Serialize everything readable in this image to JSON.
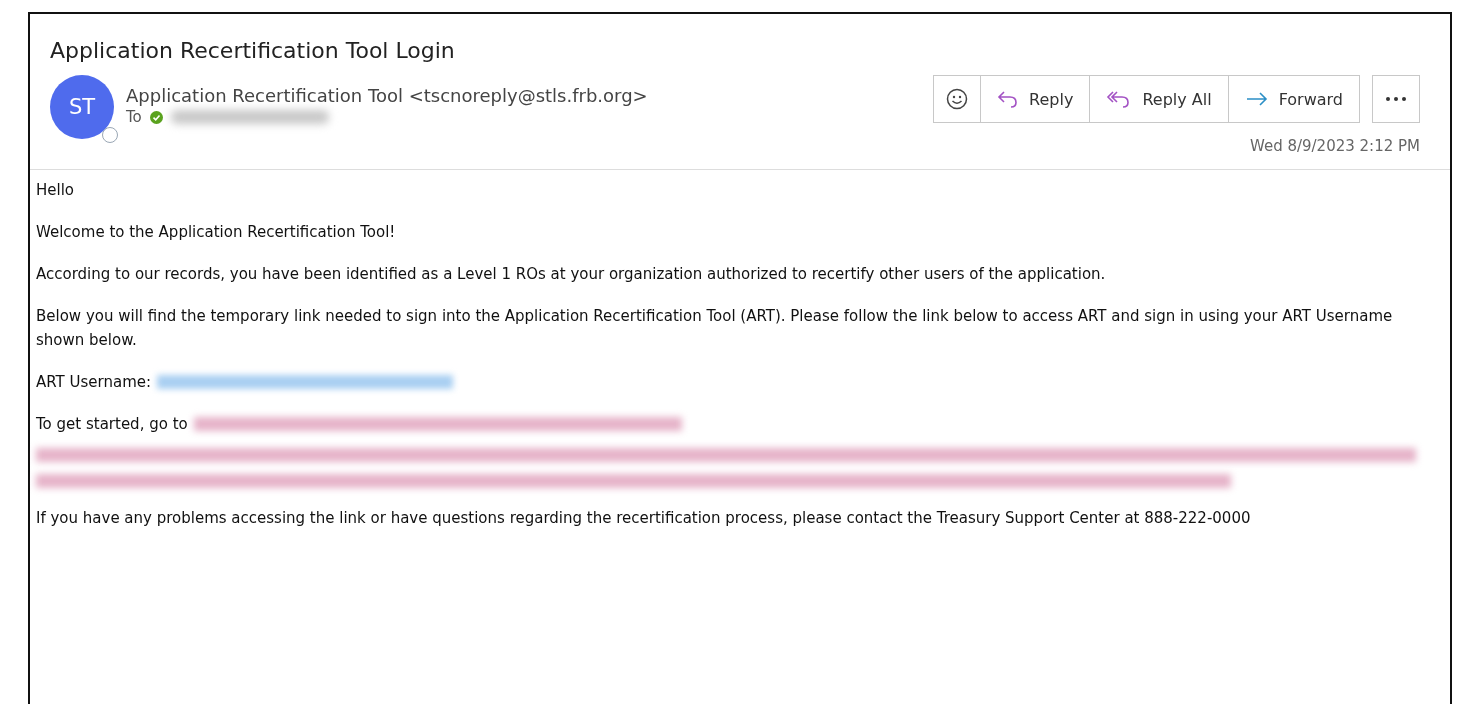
{
  "subject": "Application Recertification Tool Login",
  "sender": {
    "initials": "ST",
    "name": "Application Recertification Tool <tscnoreply@stls.frb.org>",
    "to_label": "To"
  },
  "actions": [
    {
      "kind": "emoji"
    },
    {
      "kind": "reply",
      "label": "Reply"
    },
    {
      "kind": "reply_all",
      "label": "Reply All"
    },
    {
      "kind": "forward",
      "label": "Forward"
    }
  ],
  "date": "Wed 8/9/2023 2:12 PM",
  "body": {
    "greeting": "Hello",
    "paragraphs": [
      "Welcome to the Application Recertification Tool!",
      "According to our records, you have been identified as a Level 1 ROs at your organization authorized to recertify other users of the application.",
      "Below you will find the temporary link needed to sign into the Application Recertification Tool (ART). Please follow the link below to access ART and sign in using your ART Username shown below."
    ],
    "username_label": "ART Username:",
    "start_label": "To get started, go to",
    "closing": "If you have any problems accessing the link or have questions regarding the recertification process, please contact the Treasury Support Center at 888-222-0000"
  }
}
